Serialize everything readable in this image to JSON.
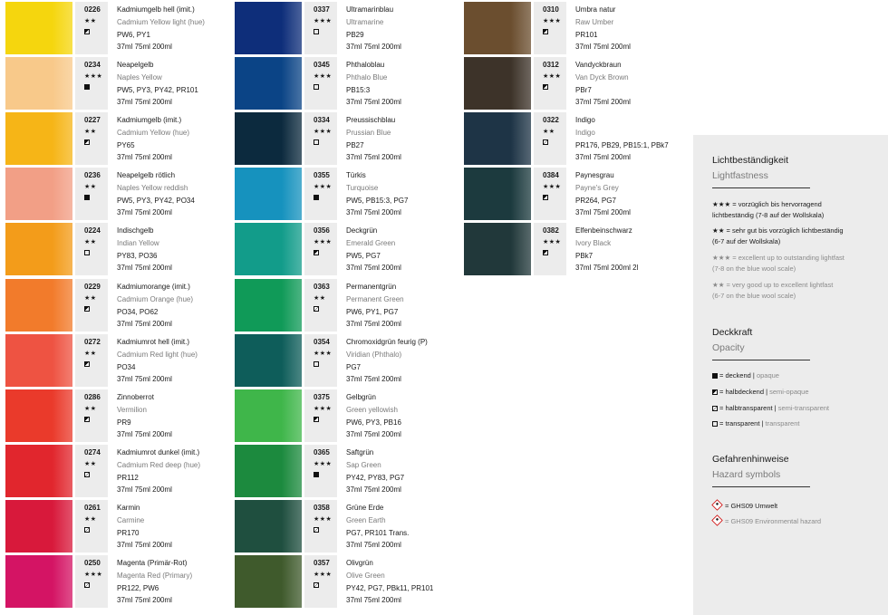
{
  "colors": [
    [
      {
        "code": "0226",
        "name": "Kadmiumgelb hell (imit.)",
        "en": "Cadmium Yellow light (hue)",
        "stars": "★★",
        "opacity": "semi-opaque",
        "pigments": "PW6, PY1",
        "sizes": "37ml    75ml    200ml",
        "color": "#F5D60E"
      },
      {
        "code": "0234",
        "name": "Neapelgelb",
        "en": "Naples Yellow",
        "stars": "★★★",
        "opacity": "opaque",
        "pigments": "PW5, PY3, PY42, PR101",
        "sizes": "37ml    75ml    200ml",
        "color": "#F8C98A"
      },
      {
        "code": "0227",
        "name": "Kadmiumgelb (imit.)",
        "en": "Cadmium Yellow (hue)",
        "stars": "★★",
        "opacity": "semi-opaque",
        "pigments": "PY65",
        "sizes": "37ml    75ml    200ml",
        "color": "#F6B517"
      },
      {
        "code": "0236",
        "name": "Neapelgelb rötlich",
        "en": "Naples Yellow reddish",
        "stars": "★★",
        "opacity": "opaque",
        "pigments": "PW5, PY3, PY42, PO34",
        "sizes": "37ml    75ml    200ml",
        "color": "#F29F86"
      },
      {
        "code": "0224",
        "name": "Indischgelb",
        "en": "Indian Yellow",
        "stars": "★★",
        "opacity": "transparent",
        "pigments": "PY83, PO36",
        "sizes": "37ml    75ml    200ml",
        "color": "#F39C1A"
      },
      {
        "code": "0229",
        "name": "Kadmiumorange (imit.)",
        "en": "Cadmium Orange (hue)",
        "stars": "★★",
        "opacity": "semi-opaque",
        "pigments": "PO34, PO62",
        "sizes": "37ml    75ml    200ml",
        "color": "#F27B2B"
      },
      {
        "code": "0272",
        "name": "Kadmiumrot hell (imit.)",
        "en": "Cadmium Red light (hue)",
        "stars": "★★",
        "opacity": "semi-opaque",
        "pigments": "PO34",
        "sizes": "37ml    75ml    200ml",
        "color": "#EE5342"
      },
      {
        "code": "0286",
        "name": "Zinnoberrot",
        "en": "Vermilion",
        "stars": "★★",
        "opacity": "semi-opaque",
        "pigments": "PR9",
        "sizes": "37ml    75ml    200ml",
        "color": "#EA3A2B"
      },
      {
        "code": "0274",
        "name": "Kadmiumrot dunkel (imit.)",
        "en": "Cadmium Red deep (hue)",
        "stars": "★★",
        "opacity": "semi-transparent",
        "pigments": "PR112",
        "sizes": "37ml    75ml    200ml",
        "color": "#E1262D"
      },
      {
        "code": "0261",
        "name": "Karmin",
        "en": "Carmine",
        "stars": "★★",
        "opacity": "semi-transparent",
        "pigments": "PR170",
        "sizes": "37ml    75ml    200ml",
        "color": "#D8193B"
      },
      {
        "code": "0250",
        "name": "Magenta (Primär-Rot)",
        "en": "Magenta Red (Primary)",
        "stars": "★★★",
        "opacity": "semi-transparent",
        "pigments": "PR122, PW6",
        "sizes": "37ml    75ml    200ml",
        "color": "#D41464"
      }
    ],
    [
      {
        "code": "0337",
        "name": "Ultramarinblau",
        "en": "Ultramarine",
        "stars": "★★★",
        "opacity": "transparent",
        "pigments": "PB29",
        "sizes": "37ml    75ml    200ml",
        "color": "#0E2E7A"
      },
      {
        "code": "0345",
        "name": "Phthaloblau",
        "en": "Phthalo Blue",
        "stars": "★★★",
        "opacity": "transparent",
        "pigments": "PB15:3",
        "sizes": "37ml    75ml    200ml",
        "color": "#0B4486"
      },
      {
        "code": "0334",
        "name": "Preussischblau",
        "en": "Prussian Blue",
        "stars": "★★★",
        "opacity": "transparent",
        "pigments": "PB27",
        "sizes": "37ml    75ml    200ml",
        "color": "#0C2A3E"
      },
      {
        "code": "0355",
        "name": "Türkis",
        "en": "Turquoise",
        "stars": "★★★",
        "opacity": "opaque",
        "pigments": "PW5, PB15:3, PG7",
        "sizes": "37ml    75ml    200ml",
        "color": "#1692BE"
      },
      {
        "code": "0356",
        "name": "Deckgrün",
        "en": "Emerald Green",
        "stars": "★★★",
        "opacity": "semi-opaque",
        "pigments": "PW5, PG7",
        "sizes": "37ml    75ml    200ml",
        "color": "#129C8A"
      },
      {
        "code": "0363",
        "name": "Permanentgrün",
        "en": "Permanent Green",
        "stars": "★★",
        "opacity": "semi-transparent",
        "pigments": "PW6, PY1, PG7",
        "sizes": "37ml    75ml    200ml",
        "color": "#109A58"
      },
      {
        "code": "0354",
        "name": "Chromoxidgrün feurig (P)",
        "en": "Viridian (Phthalo)",
        "stars": "★★★",
        "opacity": "transparent",
        "pigments": "PG7",
        "sizes": "37ml    75ml    200ml",
        "color": "#0E5D5A"
      },
      {
        "code": "0375",
        "name": "Gelbgrün",
        "en": "Green yellowish",
        "stars": "★★★",
        "opacity": "semi-opaque",
        "pigments": "PW6, PY3, PB16",
        "sizes": "37ml    75ml    200ml",
        "color": "#3FB64A"
      },
      {
        "code": "0365",
        "name": "Saftgrün",
        "en": "Sap Green",
        "stars": "★★★",
        "opacity": "opaque",
        "pigments": "PY42, PY83, PG7",
        "sizes": "37ml    75ml    200ml",
        "color": "#1C8A3E"
      },
      {
        "code": "0358",
        "name": "Grüne Erde",
        "en": "Green Earth",
        "stars": "★★★",
        "opacity": "semi-transparent",
        "pigments": "PG7, PR101 Trans.",
        "sizes": "37ml    75ml    200ml",
        "color": "#1F4F3F"
      },
      {
        "code": "0357",
        "name": "Olivgrün",
        "en": "Olive Green",
        "stars": "★★★",
        "opacity": "semi-transparent",
        "pigments": "PY42, PG7, PBk11, PR101",
        "sizes": "37ml    75ml    200ml",
        "color": "#3F5A2C"
      }
    ],
    [
      {
        "code": "0310",
        "name": "Umbra natur",
        "en": "Raw Umber",
        "stars": "★★★",
        "opacity": "semi-opaque",
        "pigments": "PR101",
        "sizes": "37ml    75ml    200ml",
        "color": "#6B4E2F"
      },
      {
        "code": "0312",
        "name": "Vandyckbraun",
        "en": "Van Dyck Brown",
        "stars": "★★★",
        "opacity": "semi-opaque",
        "pigments": "PBr7",
        "sizes": "37ml    75ml    200ml",
        "color": "#3D3329"
      },
      {
        "code": "0322",
        "name": "Indigo",
        "en": "Indigo",
        "stars": "★★",
        "opacity": "semi-transparent",
        "pigments": "PR176, PB29, PB15:1, PBk7",
        "sizes": "37ml    75ml    200ml",
        "color": "#1E3446"
      },
      {
        "code": "0384",
        "name": "Paynesgrau",
        "en": "Payne's Grey",
        "stars": "★★★",
        "opacity": "semi-opaque",
        "pigments": "PR264, PG7",
        "sizes": "37ml    75ml    200ml",
        "color": "#1C3A3E"
      },
      {
        "code": "0382",
        "name": "Elfenbeinschwarz",
        "en": "Ivory Black",
        "stars": "★★★",
        "opacity": "semi-opaque",
        "pigments": "PBk7",
        "sizes": "37ml    75ml    200ml    2l",
        "color": "#21383A"
      }
    ]
  ],
  "legend": {
    "lightfastness": {
      "title": "Lichtbeständigkeit",
      "title_en": "Lightfastness",
      "line1": "★★★  = vorzüglich bis hervorragend",
      "line1b": "lichtbeständig (7-8 auf der Wollskala)",
      "line2": "★★ = sehr gut bis vorzüglich lichtbeständig",
      "line2b": "(6-7 auf der Wollskala)",
      "line3": "★★★  = excellent up to outstanding lightfast",
      "line3b": "(7-8 on the blue wool scale)",
      "line4": "★★ = very good up to excellent lightfast",
      "line4b": "(6-7 on the blue wool scale)"
    },
    "opacity": {
      "title": "Deckkraft",
      "title_en": "Opacity",
      "opaque_de": "deckend",
      "opaque_en": "opaque",
      "semiop_de": "halbdeckend",
      "semiop_en": "semi-opaque",
      "semitr_de": "halbtransparent",
      "semitr_en": "semi-transparent",
      "trans_de": "transparent",
      "trans_en": "transparent"
    },
    "hazard": {
      "title": "Gefahrenhinweise",
      "title_en": "Hazard symbols",
      "de": "= GHS09 Umwelt",
      "en": "= GHS09 Environmental hazard"
    }
  }
}
